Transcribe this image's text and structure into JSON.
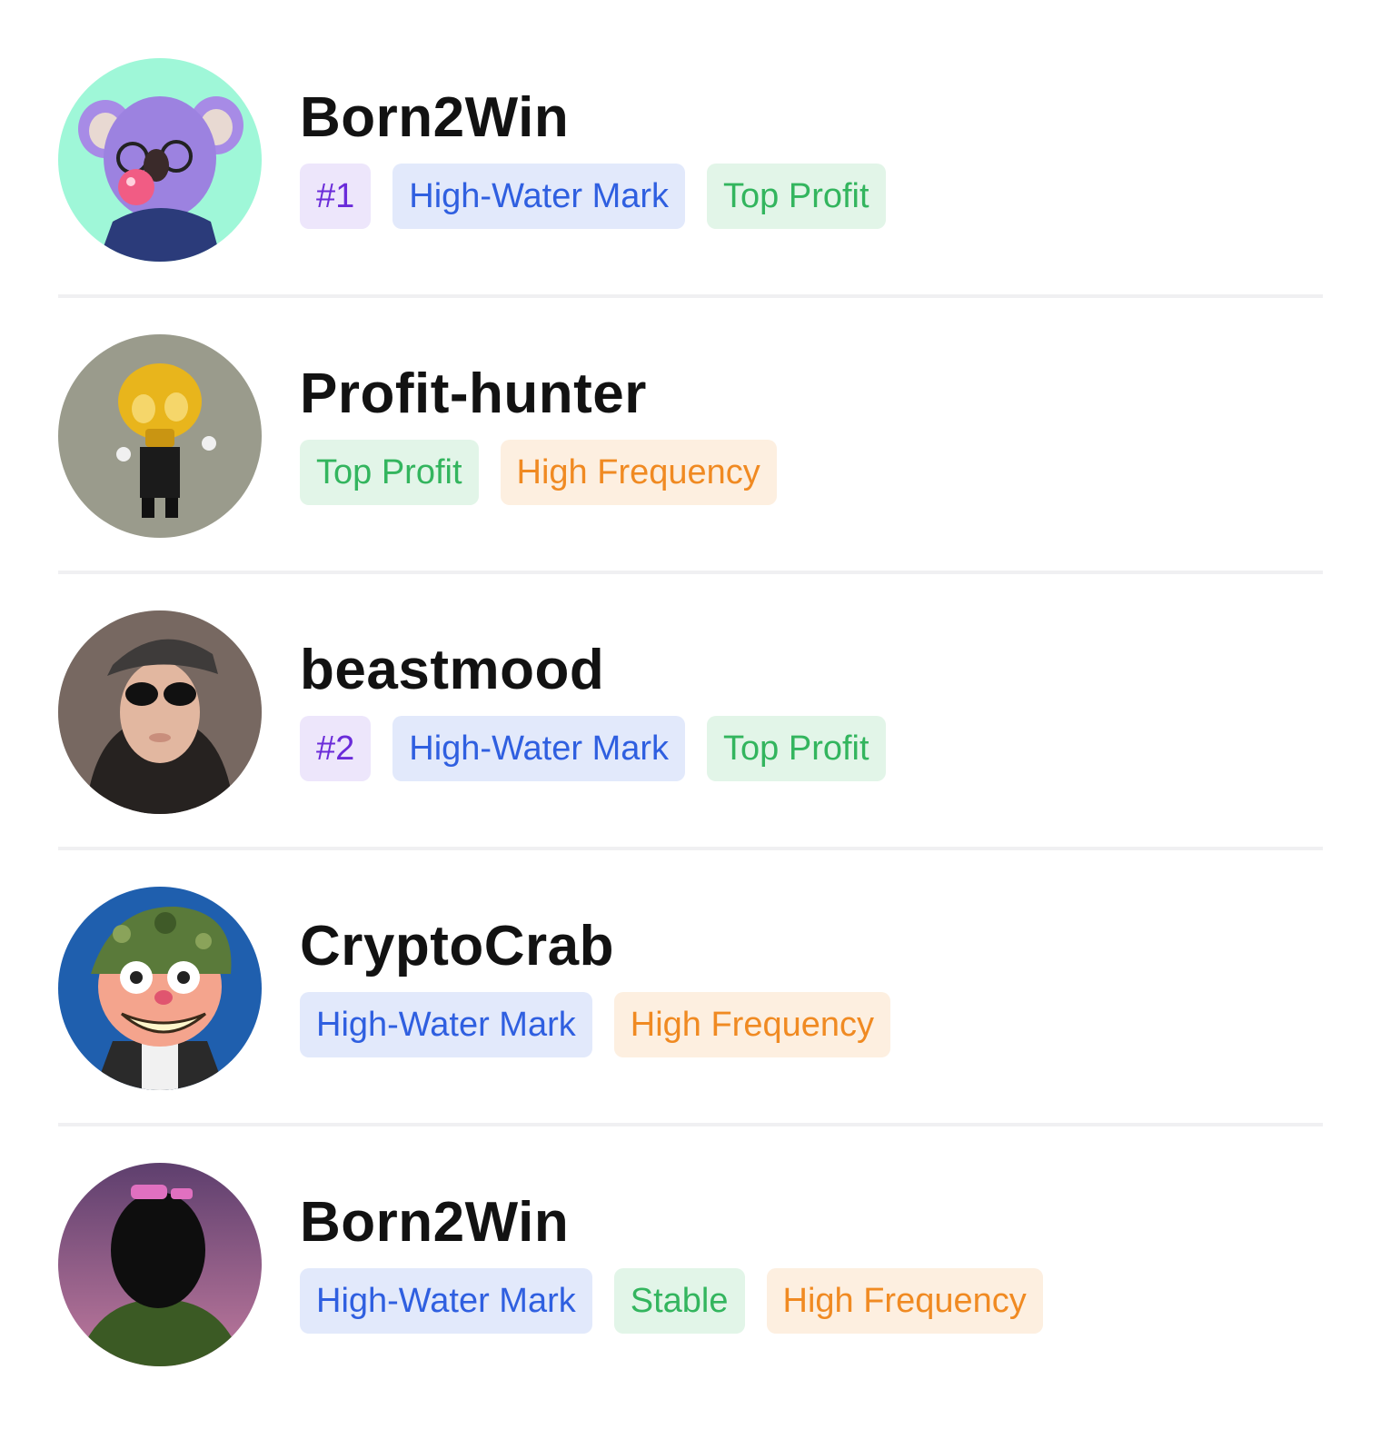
{
  "traders": [
    {
      "name": "Born2Win",
      "avatar_icon": "koala-avatar-icon",
      "avatar_bg": "#9ff7d8",
      "tags": [
        {
          "label": "#1",
          "kind": "rank"
        },
        {
          "label": "High-Water Mark",
          "kind": "hwm"
        },
        {
          "label": "Top Profit",
          "kind": "top"
        }
      ]
    },
    {
      "name": "Profit-hunter",
      "avatar_icon": "gold-skull-avatar-icon",
      "avatar_bg": "#9a9b8c",
      "tags": [
        {
          "label": "Top Profit",
          "kind": "top"
        },
        {
          "label": "High Frequency",
          "kind": "freq"
        }
      ]
    },
    {
      "name": "beastmood",
      "avatar_icon": "person-sunglasses-avatar-icon",
      "avatar_bg": "#6b5d55",
      "tags": [
        {
          "label": "#2",
          "kind": "rank"
        },
        {
          "label": "High-Water Mark",
          "kind": "hwm"
        },
        {
          "label": "Top Profit",
          "kind": "top"
        }
      ]
    },
    {
      "name": "CryptoCrab",
      "avatar_icon": "soldier-cartoon-avatar-icon",
      "avatar_bg": "#1f5fae",
      "tags": [
        {
          "label": "High-Water Mark",
          "kind": "hwm"
        },
        {
          "label": "High Frequency",
          "kind": "freq"
        }
      ]
    },
    {
      "name": "Born2Win",
      "avatar_icon": "ape-silhouette-avatar-icon",
      "avatar_bg": "#8a5a7e",
      "tags": [
        {
          "label": "High-Water Mark",
          "kind": "hwm"
        },
        {
          "label": "Stable",
          "kind": "stable"
        },
        {
          "label": "High Frequency",
          "kind": "freq"
        }
      ]
    }
  ]
}
